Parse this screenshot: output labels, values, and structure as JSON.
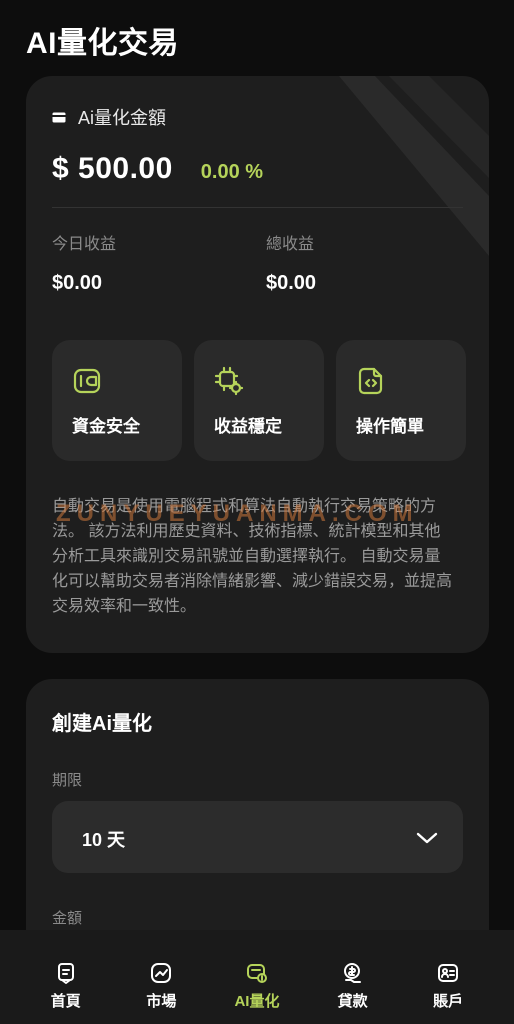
{
  "page": {
    "title": "AI量化交易"
  },
  "summary": {
    "header_label": "Ai量化金額",
    "amount": "$ 500.00",
    "percent": "0.00 %",
    "today_label": "今日收益",
    "today_value": "$0.00",
    "total_label": "總收益",
    "total_value": "$0.00"
  },
  "features": [
    {
      "label": "資金安全",
      "icon": "wallet-icon"
    },
    {
      "label": "收益穩定",
      "icon": "gear-chip-icon"
    },
    {
      "label": "操作簡單",
      "icon": "code-file-icon"
    }
  ],
  "description": "自動交易是使用電腦程式和算法自動執行交易策略的方法。 該方法利用歷史資料、技術指標、統計模型和其他分析工具來識別交易訊號並自動選擇執行。 自動交易量化可以幫助交易者消除情緒影響、減少錯誤交易，並提高交易效率和一致性。",
  "watermark": "ZUNYUEYUANMA.COM",
  "create": {
    "title": "創建Ai量化",
    "period_label": "期限",
    "period_value": "10 天",
    "amount_label": "金額"
  },
  "tabbar": {
    "items": [
      {
        "label": "首頁",
        "icon": "home-icon",
        "active": false
      },
      {
        "label": "市場",
        "icon": "market-icon",
        "active": false
      },
      {
        "label": "AI量化",
        "icon": "ai-quant-icon",
        "active": true
      },
      {
        "label": "貸款",
        "icon": "loan-icon",
        "active": false
      },
      {
        "label": "賬戶",
        "icon": "account-icon",
        "active": false
      }
    ]
  },
  "colors": {
    "accent": "#b5d35a",
    "background": "#0d0d0d",
    "card": "#1e1e1e"
  }
}
